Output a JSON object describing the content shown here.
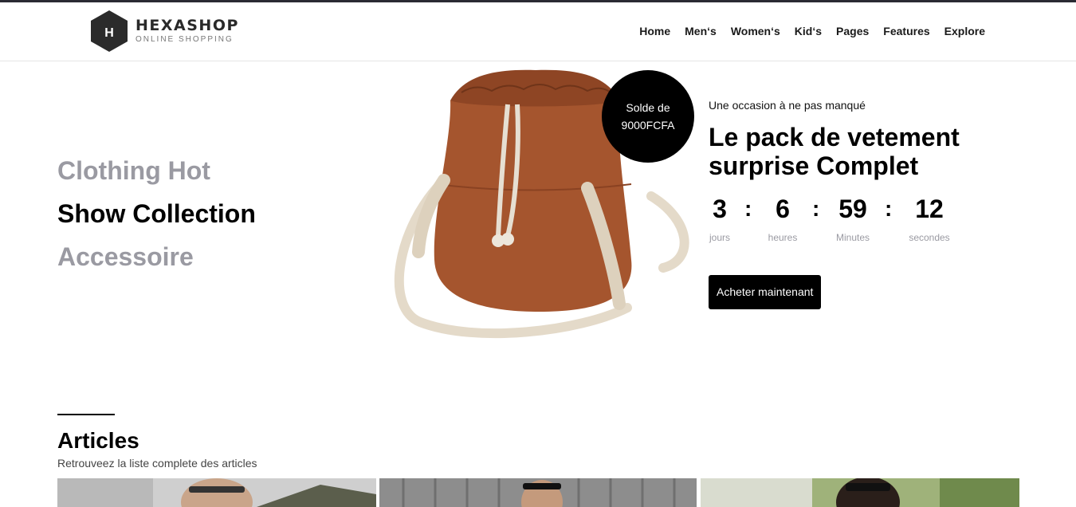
{
  "brand": {
    "name": "HEXASHOP",
    "tagline": "ONLINE SHOPPING",
    "logo_letter": "H"
  },
  "nav": [
    "Home",
    "Men‘s",
    "Women‘s",
    "Kid‘s",
    "Pages",
    "Features",
    "Explore"
  ],
  "left_menu": {
    "item1": "Clothing Hot",
    "item2": "Show Collection",
    "item3": "Accessoire"
  },
  "badge": {
    "line1": "Solde de",
    "line2": "9000FCFA"
  },
  "promo": {
    "kicker": "Une occasion à ne pas manqué",
    "title": "Le pack de vetement surprise Complet",
    "countdown": {
      "days": "3",
      "days_label": "jours",
      "hours": "6",
      "hours_label": "heures",
      "minutes": "59",
      "minutes_label": "Minutes",
      "seconds": "12",
      "seconds_label": "secondes",
      "separator": ":"
    },
    "buy_label": "Acheter maintenant"
  },
  "articles": {
    "title": "Articles",
    "subtitle": "Retrouveez la liste complete des articles"
  },
  "colors": {
    "accent": "#000000",
    "muted": "#9a9aa2",
    "bag": "#a5552e",
    "strap": "#e4dac9"
  }
}
